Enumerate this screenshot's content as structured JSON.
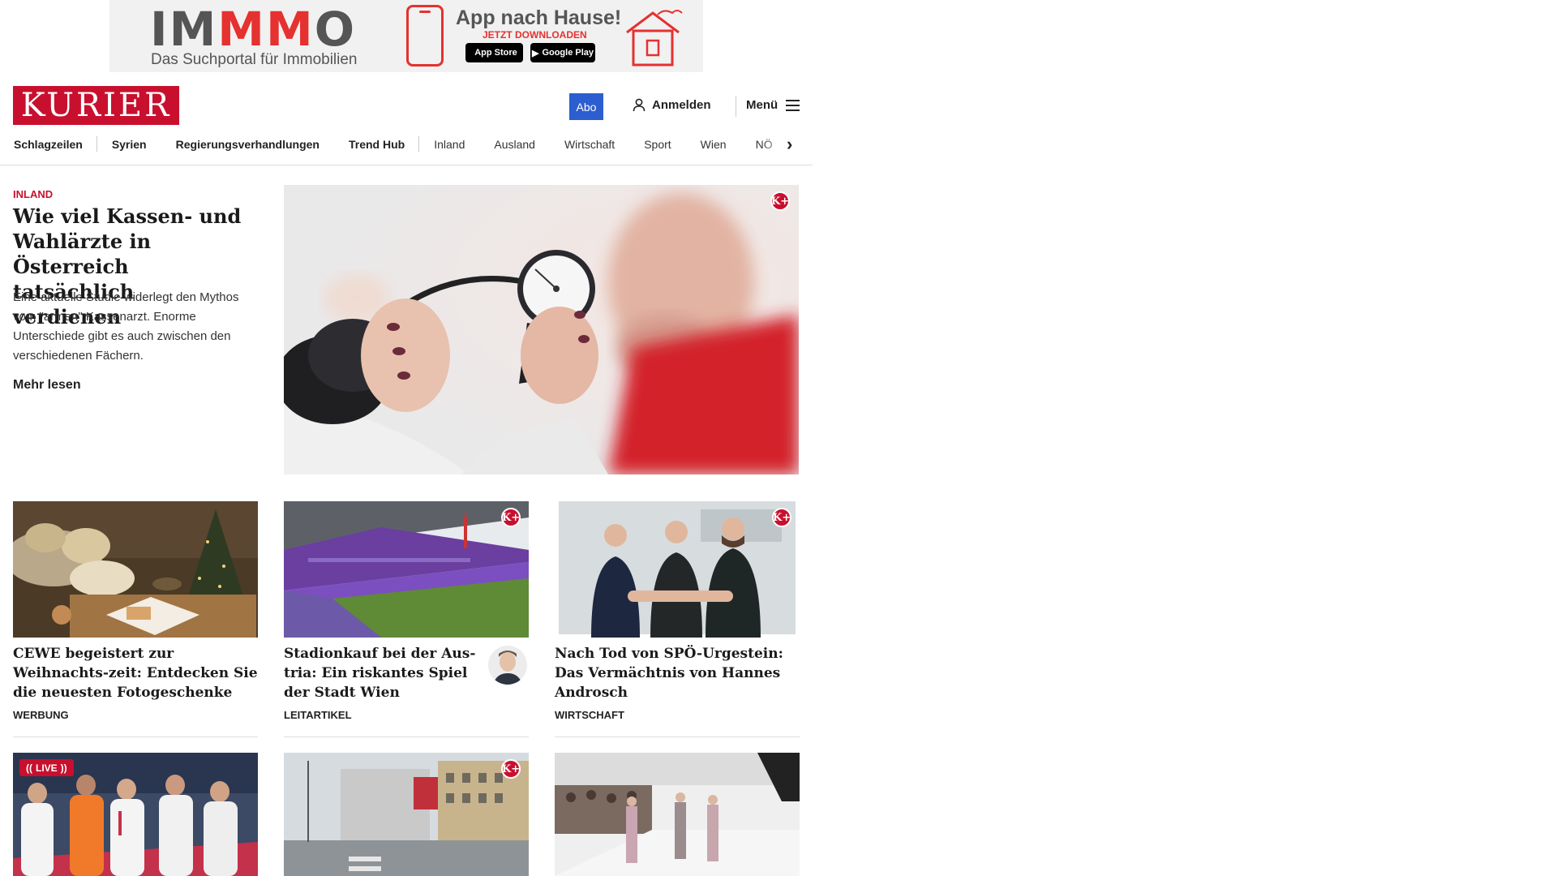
{
  "ad": {
    "logo_left": "IM",
    "logo_mid": "MM",
    "logo_right": "O",
    "tagline": "Das Suchportal für Immobilien",
    "title": "App nach Hause!",
    "subtitle": "JETZT DOWNLOADEN",
    "apple_store": "App Store",
    "google_play": "Google Play",
    "brand_color": "#e5312f"
  },
  "header": {
    "logo": "KURIER",
    "abo_label": "Abo",
    "login_label": "Anmelden",
    "menu_label": "Menü",
    "brand_color": "#c8102e",
    "abo_color": "#2c5ecf"
  },
  "nav": {
    "items": [
      {
        "label": "Schlagzeilen"
      },
      {
        "label": "Syrien"
      },
      {
        "label": "Regierungsverhandlungen"
      },
      {
        "label": "Trend Hub"
      },
      {
        "label": "Inland"
      },
      {
        "label": "Ausland"
      },
      {
        "label": "Wirtschaft"
      },
      {
        "label": "Sport"
      },
      {
        "label": "Wien"
      },
      {
        "label": "NÖ"
      }
    ]
  },
  "lead": {
    "kicker": "INLAND",
    "title": "Wie viel Kassen- und Wahlärzte in Österreich tatsächlich verdienen",
    "teaser": "Eine aktuelle Studie widerlegt den Mythos vom \"armen\" Kassenarzt. Enorme Unterschiede gibt es auch zwischen den verschiedenen Fächern.",
    "read_more": "Mehr lesen",
    "premium_badge": "K+"
  },
  "cards": [
    {
      "title": "CEWE begeistert zur Weihnachts-zeit: Entdecken Sie die neuesten Fotogeschenke",
      "label": "WERBUNG"
    },
    {
      "title": "Stadionkauf bei der Aus-tria: Ein riskantes Spiel der Stadt Wien",
      "label": "LEITARTIKEL",
      "premium_badge": "K+"
    },
    {
      "title": "Nach Tod von SPÖ-Urgestein: Das Vermächtnis von Hannes Androsch",
      "label": "WIRTSCHAFT",
      "premium_badge": "K+"
    }
  ],
  "row2": {
    "live_label": "LIVE",
    "premium_badge": "K+"
  }
}
